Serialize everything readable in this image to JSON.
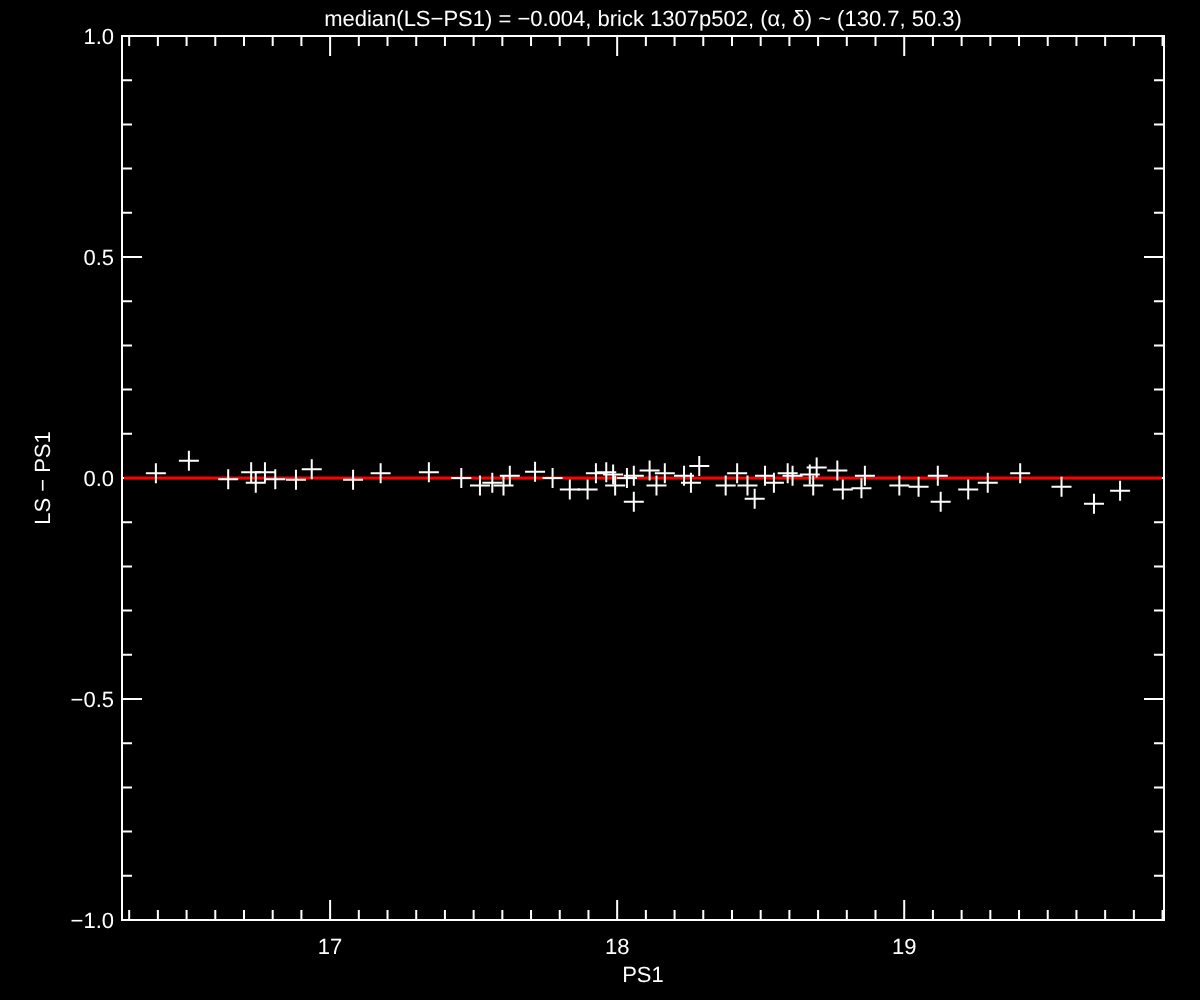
{
  "plot": {
    "chart_data": {
      "type": "scatter",
      "title": "median(LS−PS1) = −0.004, brick 1307p502, (α, δ) ~ (130.7, 50.3)",
      "xlabel": "PS1",
      "ylabel": "LS − PS1",
      "xlim": [
        16.275,
        19.905
      ],
      "ylim": [
        -1.0,
        1.0
      ],
      "xticks": [
        17,
        18,
        19
      ],
      "yticks": [
        {
          "value": -1.0,
          "label": "−1.0"
        },
        {
          "value": -0.5,
          "label": "−0.5"
        },
        {
          "value": 0.0,
          "label": "0.0"
        },
        {
          "value": 0.5,
          "label": "0.5"
        },
        {
          "value": 1.0,
          "label": "1.0"
        }
      ],
      "ref_lines": [
        {
          "axis": "y",
          "value": 0.0,
          "color": "#ff0000"
        }
      ],
      "series": [
        {
          "color": "#ffffff",
          "x": [
            16.393,
            16.508,
            16.645,
            16.725,
            16.741,
            16.773,
            16.809,
            16.881,
            16.936,
            17.08,
            17.176,
            17.344,
            17.457,
            17.522,
            17.565,
            17.604,
            17.626,
            17.714,
            17.775,
            17.835,
            17.897,
            17.926,
            17.962,
            17.986,
            17.993,
            18.034,
            18.058,
            18.058,
            18.113,
            18.137,
            18.166,
            18.233,
            18.257,
            18.286,
            18.378,
            18.418,
            18.454,
            18.479,
            18.515,
            18.546,
            18.594,
            18.611,
            18.671,
            18.683,
            18.695,
            18.767,
            18.786,
            18.851,
            18.863,
            18.983,
            19.05,
            19.117,
            19.127,
            19.223,
            19.291,
            19.404,
            19.548,
            19.661,
            19.752
          ],
          "values": [
            0.011,
            0.039,
            -0.003,
            0.013,
            -0.011,
            0.013,
            -0.003,
            -0.004,
            0.02,
            -0.004,
            0.011,
            0.013,
            0.0,
            -0.017,
            -0.011,
            -0.017,
            0.005,
            0.014,
            0.0,
            -0.026,
            -0.026,
            0.011,
            0.013,
            0.008,
            -0.017,
            0.0,
            0.005,
            -0.054,
            0.017,
            -0.017,
            0.011,
            0.005,
            -0.011,
            0.027,
            -0.017,
            0.011,
            -0.017,
            -0.047,
            0.005,
            -0.011,
            0.011,
            0.005,
            0.008,
            -0.017,
            0.024,
            0.017,
            -0.026,
            -0.023,
            0.005,
            -0.017,
            -0.02,
            0.005,
            -0.054,
            -0.026,
            -0.011,
            0.011,
            -0.02,
            -0.058,
            -0.029
          ]
        }
      ]
    }
  }
}
